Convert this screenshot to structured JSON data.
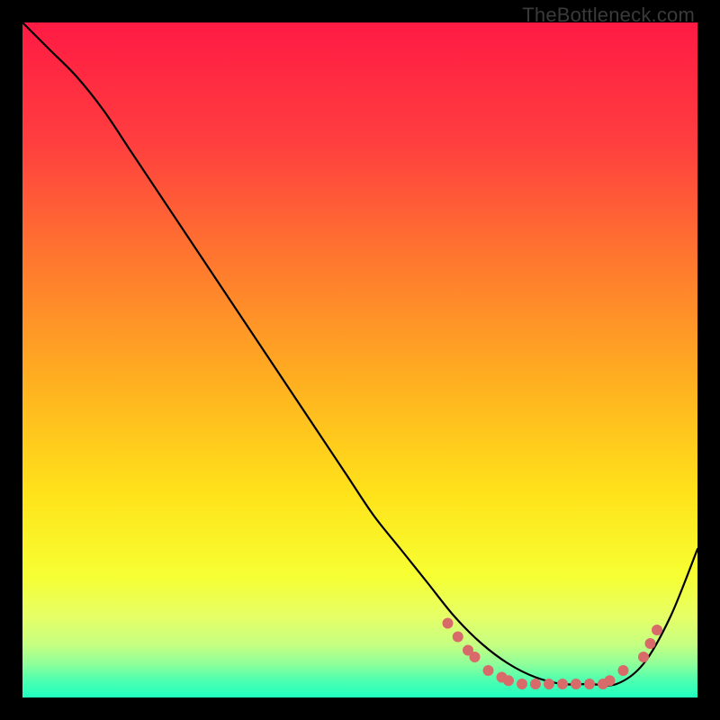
{
  "watermark": "TheBottleneck.com",
  "chart_data": {
    "type": "line",
    "title": "",
    "xlabel": "",
    "ylabel": "",
    "xlim": [
      0,
      100
    ],
    "ylim": [
      0,
      100
    ],
    "background_gradient": {
      "stops": [
        {
          "pos": 0.0,
          "color": "#ff1a44"
        },
        {
          "pos": 0.18,
          "color": "#ff3f3f"
        },
        {
          "pos": 0.36,
          "color": "#ff7a2e"
        },
        {
          "pos": 0.55,
          "color": "#ffb51f"
        },
        {
          "pos": 0.7,
          "color": "#ffe31a"
        },
        {
          "pos": 0.82,
          "color": "#f6ff33"
        },
        {
          "pos": 0.88,
          "color": "#e6ff66"
        },
        {
          "pos": 0.92,
          "color": "#c8ff80"
        },
        {
          "pos": 0.95,
          "color": "#8fff9a"
        },
        {
          "pos": 0.975,
          "color": "#4dffb0"
        },
        {
          "pos": 1.0,
          "color": "#1fffc0"
        }
      ]
    },
    "series": [
      {
        "name": "bottleneck-curve",
        "x": [
          0,
          4,
          8,
          12,
          16,
          20,
          24,
          28,
          32,
          36,
          40,
          44,
          48,
          52,
          56,
          60,
          64,
          68,
          72,
          76,
          80,
          84,
          88,
          92,
          96,
          100
        ],
        "y": [
          100,
          96,
          92,
          87,
          81,
          75,
          69,
          63,
          57,
          51,
          45,
          39,
          33,
          27,
          22,
          17,
          12,
          8,
          5,
          3,
          2,
          2,
          2,
          5,
          12,
          22
        ]
      }
    ],
    "marker_points": {
      "name": "highlighted-dots",
      "color": "#d86a6a",
      "radius_px": 6,
      "points_xy": [
        [
          63,
          11
        ],
        [
          64.5,
          9
        ],
        [
          66,
          7
        ],
        [
          67,
          6
        ],
        [
          69,
          4
        ],
        [
          71,
          3
        ],
        [
          72,
          2.5
        ],
        [
          74,
          2
        ],
        [
          76,
          2
        ],
        [
          78,
          2
        ],
        [
          80,
          2
        ],
        [
          82,
          2
        ],
        [
          84,
          2
        ],
        [
          86,
          2
        ],
        [
          87,
          2.5
        ],
        [
          89,
          4
        ],
        [
          92,
          6
        ],
        [
          93,
          8
        ],
        [
          94,
          10
        ]
      ]
    }
  }
}
